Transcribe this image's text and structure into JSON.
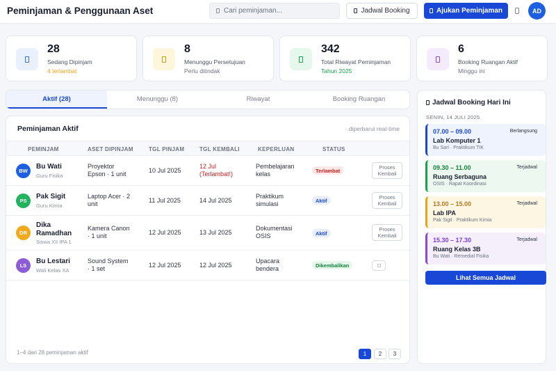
{
  "header": {
    "title": "Peminjaman & Penggunaan Aset",
    "search_placeholder": "Cari peminjaman...",
    "booking_btn": "Jadwal Booking",
    "primary_btn": "Ajukan Peminjaman",
    "avatar": "AD"
  },
  "stats": [
    {
      "value": "28",
      "label": "Sedang Dipinjam",
      "sub": "4 terlambat",
      "accent": "#e8a317"
    },
    {
      "value": "8",
      "label": "Menunggu Persetujuan",
      "sub": "Perlu ditindak",
      "accent": "#6b7280"
    },
    {
      "value": "342",
      "label": "Total Riwayat Peminjaman",
      "sub": "Tahun 2025",
      "accent": "#16a34a"
    },
    {
      "value": "6",
      "label": "Booking Ruangan Aktif",
      "sub": "Minggu ini",
      "accent": "#6b7280"
    }
  ],
  "tabs": [
    "Aktif (28)",
    "Menunggu (8)",
    "Riwayat",
    "Booking Ruangan"
  ],
  "table": {
    "title": "Peminjaman Aktif",
    "note": "· diperbarui real-time",
    "headers": [
      "PEMINJAM",
      "ASET DIPINJAM",
      "TGL PINJAM",
      "TGL KEMBALI",
      "KEPERLUAN",
      "STATUS"
    ],
    "rows": [
      {
        "initials": "BW",
        "name": "Bu Wati",
        "role": "Guru Fisika",
        "asset": [
          "Proyektor",
          "Epson · 1 unit"
        ],
        "pinjam": "10 Jul 2025",
        "kembali": [
          "12 Jul",
          "(Terlambat!)"
        ],
        "keperluan": [
          "Pembelajaran",
          "kelas"
        ],
        "status": "Terlambat",
        "action": [
          "Proses",
          "Kembali"
        ]
      },
      {
        "initials": "PS",
        "name": "Pak Sigit",
        "role": "Guru Kimia",
        "asset": [
          "Laptop Acer · 2",
          "unit"
        ],
        "pinjam": "11 Jul 2025",
        "kembali": [
          "14 Jul 2025"
        ],
        "keperluan": [
          "Praktikum",
          "simulasi"
        ],
        "status": "Aktif",
        "action": [
          "Proses",
          "Kembali"
        ]
      },
      {
        "initials": "DR",
        "name": "Dika",
        "name2": "Ramadhan",
        "role": "Siswa XII IPA 1",
        "asset": [
          "Kamera Canon",
          "· 1 unit"
        ],
        "pinjam": "12 Jul 2025",
        "kembali": [
          "13 Jul 2025"
        ],
        "keperluan": [
          "Dokumentasi",
          "OSIS"
        ],
        "status": "Aktif",
        "action": [
          "Proses",
          "Kembali"
        ]
      },
      {
        "initials": "LS",
        "name": "Bu Lestari",
        "role": "Wali Kelas XA",
        "asset": [
          "Sound System",
          "· 1 set"
        ],
        "pinjam": "12 Jul 2025",
        "kembali": [
          "12 Jul 2025"
        ],
        "keperluan": [
          "Upacara",
          "bendera"
        ],
        "status": "Dikembalikan",
        "action": []
      }
    ],
    "footer": "1–4 dari 28 peminjaman aktif",
    "pages": [
      "1",
      "2",
      "3"
    ]
  },
  "side": {
    "title": "Jadwal Booking Hari Ini",
    "date": "SENIN, 14 JULI 2025",
    "slots": [
      {
        "time": "07.00 – 09.00",
        "status": "Berlangsung",
        "room": "Lab Komputer 1",
        "meta": "Bu Sari · Praktikum TIK"
      },
      {
        "time": "09.30 – 11.00",
        "status": "Terjadwal",
        "room": "Ruang Serbaguna",
        "meta": "OSIS · Rapat Koordinasi"
      },
      {
        "time": "13.00 – 15.00",
        "status": "Terjadwal",
        "room": "Lab IPA",
        "meta": "Pak Sigit · Praktikum Kimia"
      },
      {
        "time": "15.30 – 17.30",
        "status": "Terjadwal",
        "room": "Ruang Kelas 3B",
        "meta": "Bu Wati · Remedial Fisika"
      }
    ],
    "button": "Lihat Semua Jadwal"
  }
}
